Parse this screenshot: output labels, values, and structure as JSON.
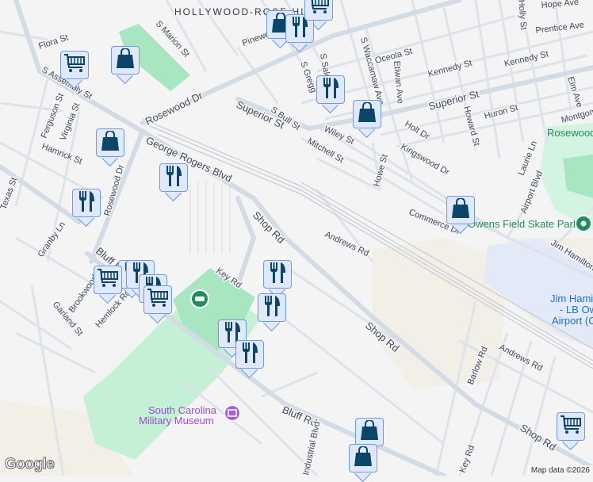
{
  "neighborhood": "HOLLYWOOD-ROSE HILL",
  "streets": [
    "Flora St",
    "S Marion St",
    "S Assembly St",
    "Rosewood Dr",
    "Ferguson St",
    "Virginia St",
    "Hamrick St",
    "George Rogers Blvd",
    "Rosewood Dr",
    "Texas St",
    "Granby Ln",
    "Bluff Rd",
    "Brookwood",
    "Garland St",
    "Hemlock Rd",
    "Key Rd",
    "Shop Rd",
    "Superior St",
    "S Bull St",
    "Pinewood",
    "S Gregg",
    "S Saluda",
    "Wiley St",
    "Mitchell St",
    "Oceola St",
    "S Waccamaw Ave",
    "Etiwan Ave",
    "Kennedy St",
    "Kennedy St",
    "Superior St",
    "Howard St",
    "Huron St",
    "Holt Dr",
    "Kingswood Dr",
    "Howe St",
    "Commerce Dr",
    "Hope Ave",
    "Prentice Ave",
    "Holly St",
    "Elm Ave",
    "Montgomery",
    "Laurie Ln",
    "Airport Blvd",
    "Andrews Rd",
    "Jim Hamilton",
    "Shop Rd",
    "Barlow Rd",
    "Andrews Rd",
    "Shop Rd",
    "Bluff Rd",
    "Industrial Blvd",
    "Key Rd",
    "Rosewood"
  ],
  "pois": {
    "park": "Rosewood Park",
    "skate": "Owens Field Skate Park",
    "museum_line1": "South Carolina",
    "museum_line2": "Military Museum",
    "airport_line1": "Jim Hamilton",
    "airport_line2": "- LB Owens",
    "airport_line3": "Airport (CUB)"
  },
  "markers": [
    {
      "icon": "shopping-cart-icon"
    },
    {
      "icon": "shopping-bag-icon"
    },
    {
      "icon": "shopping-bag-icon"
    },
    {
      "icon": "restaurant-icon"
    },
    {
      "icon": "shopping-cart-icon"
    },
    {
      "icon": "restaurant-icon"
    },
    {
      "icon": "shopping-bag-icon"
    },
    {
      "icon": "shopping-bag-icon"
    },
    {
      "icon": "restaurant-icon"
    },
    {
      "icon": "restaurant-icon"
    },
    {
      "icon": "shopping-bag-icon"
    },
    {
      "icon": "restaurant-icon"
    },
    {
      "icon": "restaurant-icon"
    },
    {
      "icon": "shopping-cart-icon"
    },
    {
      "icon": "restaurant-icon"
    },
    {
      "icon": "shopping-cart-icon"
    },
    {
      "icon": "restaurant-icon"
    },
    {
      "icon": "restaurant-icon"
    },
    {
      "icon": "restaurant-icon"
    },
    {
      "icon": "restaurant-icon"
    },
    {
      "icon": "shopping-bag-icon"
    },
    {
      "icon": "shopping-bag-icon"
    },
    {
      "icon": "shopping-cart-icon"
    }
  ],
  "colors": {
    "marker_fill": "#dfe9fb",
    "marker_border": "#6d9be0",
    "icon": "#0b4669",
    "park": "#a8e6c2",
    "road": "#d3dbe4"
  },
  "google_logo": "Google",
  "attribution": "Map data ©2026"
}
